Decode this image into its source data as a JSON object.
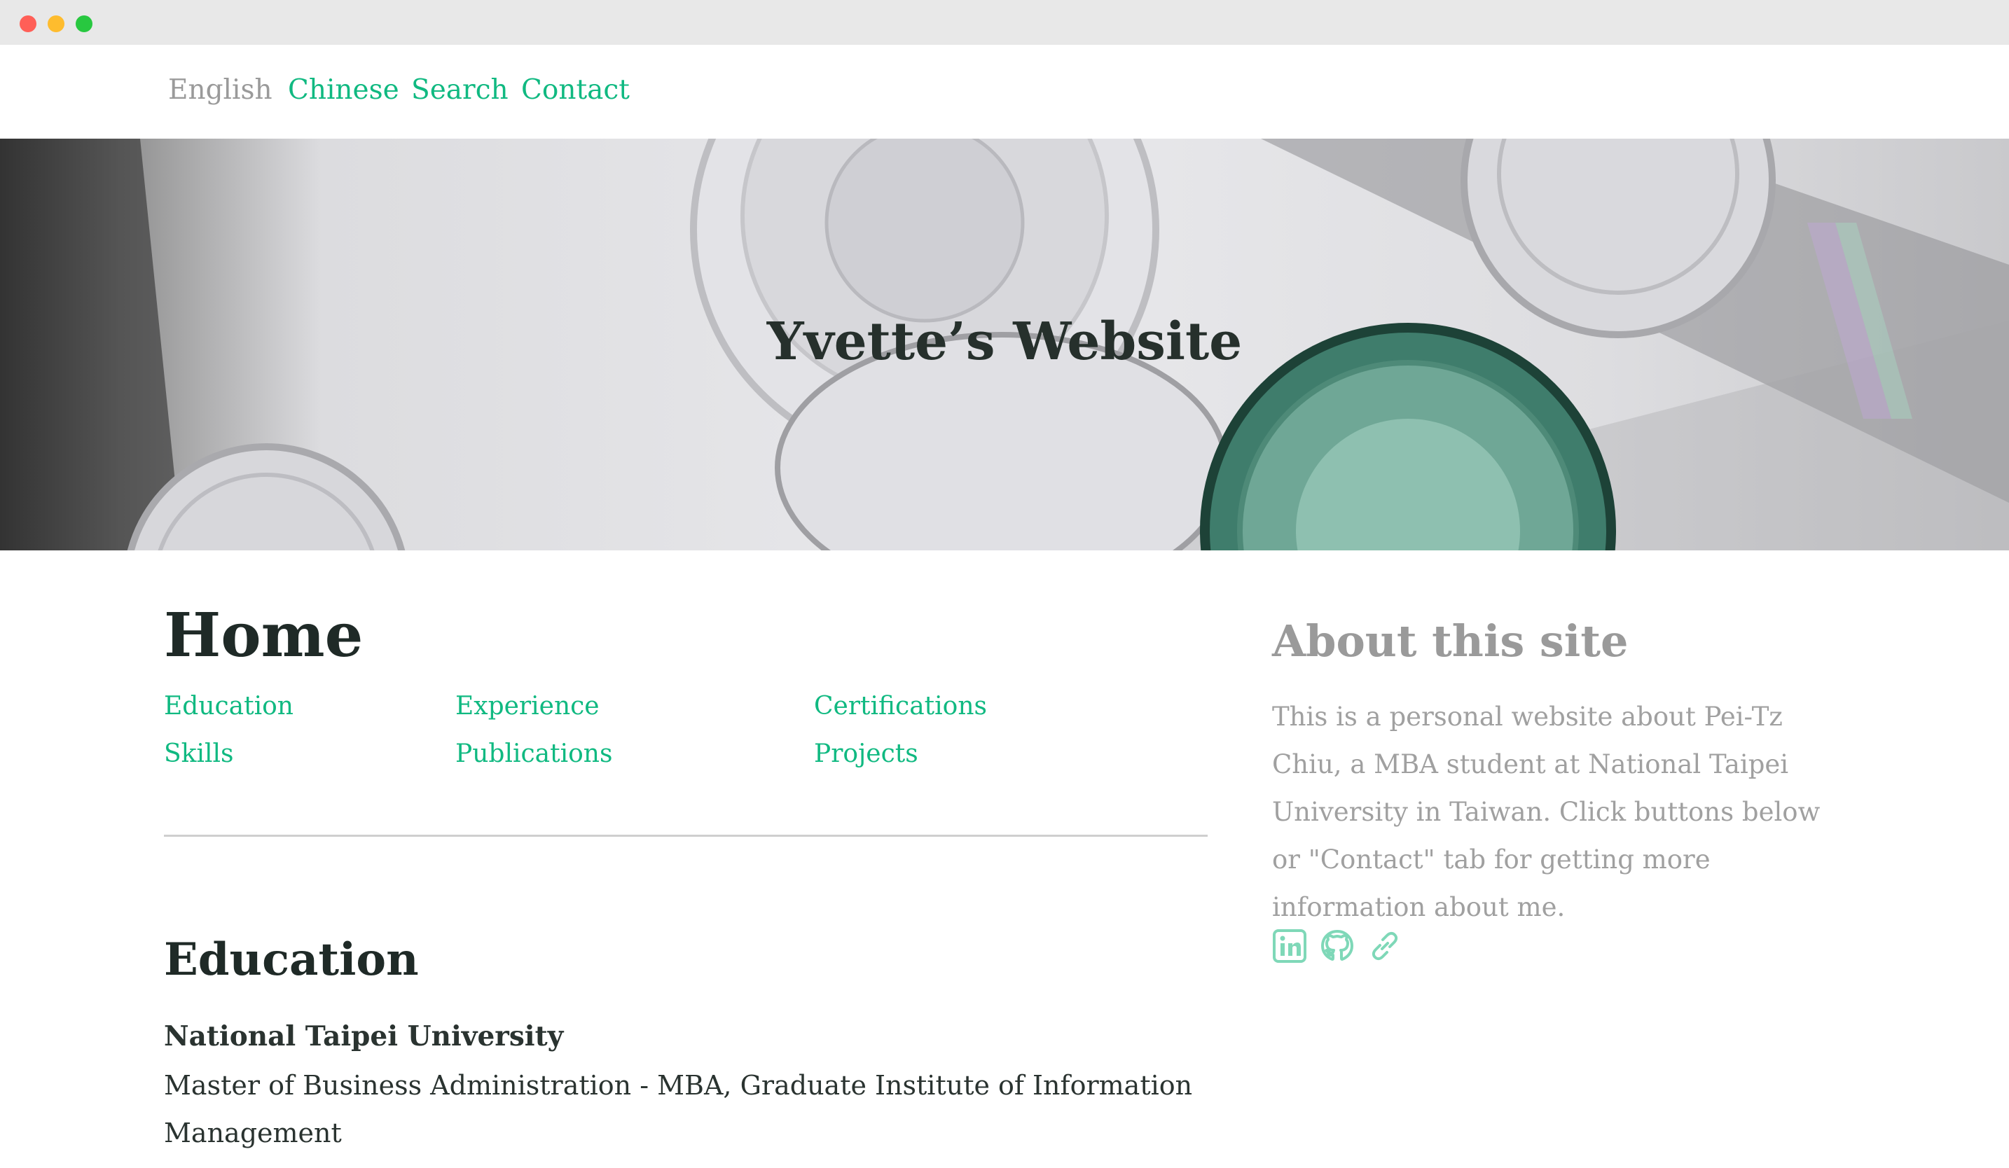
{
  "nav": {
    "items": [
      {
        "label": "English",
        "active": true
      },
      {
        "label": "Chinese",
        "active": false
      },
      {
        "label": "Search",
        "active": false
      },
      {
        "label": "Contact",
        "active": false
      }
    ]
  },
  "hero": {
    "title": "Yvette’s Website"
  },
  "main": {
    "title": "Home",
    "toc": [
      "Education",
      "Experience",
      "Certifications",
      "Skills",
      "Publications",
      "Projects"
    ],
    "education": {
      "heading": "Education",
      "school": "National Taipei University",
      "degree": "Master of Business Administration - MBA, Graduate Institute of Information Management"
    }
  },
  "sidebar": {
    "title": "About this site",
    "text": "This is a personal website about Pei-Tz Chiu, a MBA student at National Taipei University in Taiwan. Click buttons below or \"Contact\" tab for getting more information about me.",
    "icons": [
      "linkedin-icon",
      "github-icon",
      "link-icon"
    ]
  },
  "colors": {
    "accent": "#10b981",
    "muted": "#9a9a9a",
    "heading": "#1f2a27",
    "icon": "#7fd8b8"
  }
}
